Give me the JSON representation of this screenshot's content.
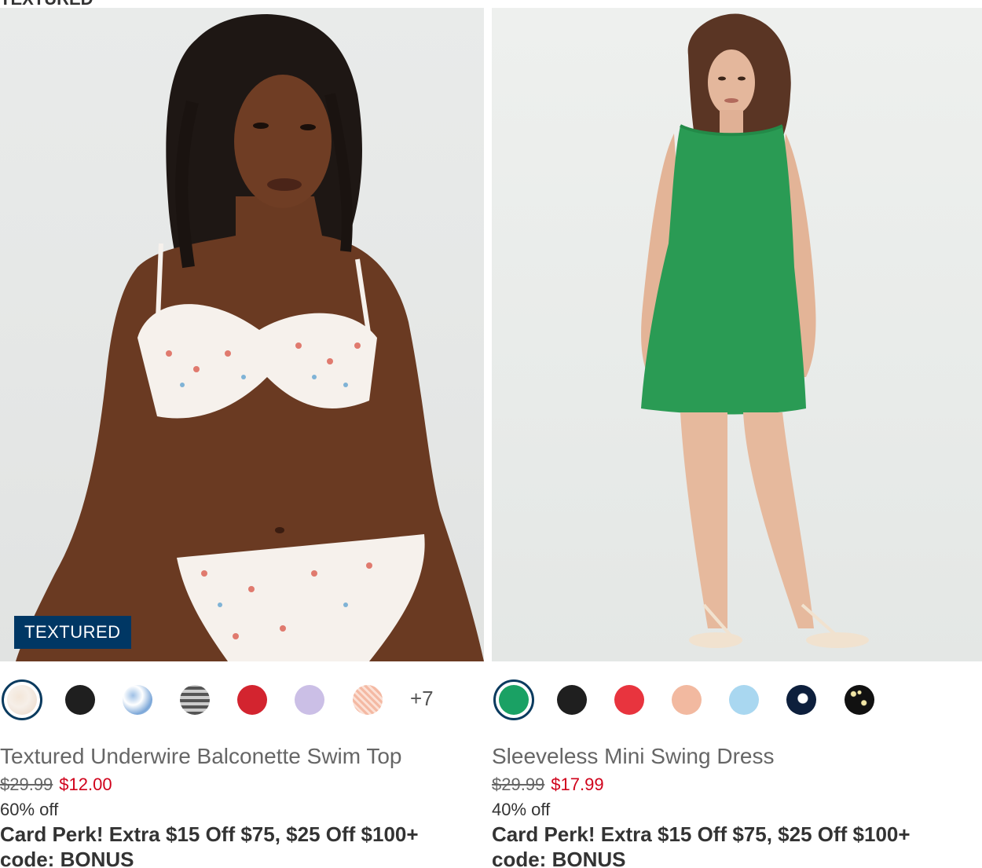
{
  "section_heading": "TEXTURED",
  "products": [
    {
      "badge": "TEXTURED",
      "title": "Textured Underwire Balconette Swim Top",
      "price_was": "$29.99",
      "price_now": "$12.00",
      "discount": "60% off",
      "perk": "Card Perk! Extra $15 Off $75, $25 Off $100+",
      "code": "code: BONUS",
      "more_colors": "+7",
      "swatches": [
        "floral-white",
        "black",
        "blue-floral",
        "gingham",
        "red",
        "lavender",
        "peach-print"
      ]
    },
    {
      "title": "Sleeveless Mini Swing Dress",
      "price_was": "$29.99",
      "price_now": "$17.99",
      "discount": "40% off",
      "perk": "Card Perk! Extra $15 Off $75, $25 Off $100+",
      "code": "code: BONUS",
      "swatches": [
        "green",
        "black",
        "red",
        "peach",
        "light-blue",
        "navy-floral",
        "black-dot"
      ]
    }
  ],
  "colors": {
    "badge_bg": "#003764",
    "sale_red": "#d0021b",
    "selected_ring": "#0b3b5f"
  }
}
